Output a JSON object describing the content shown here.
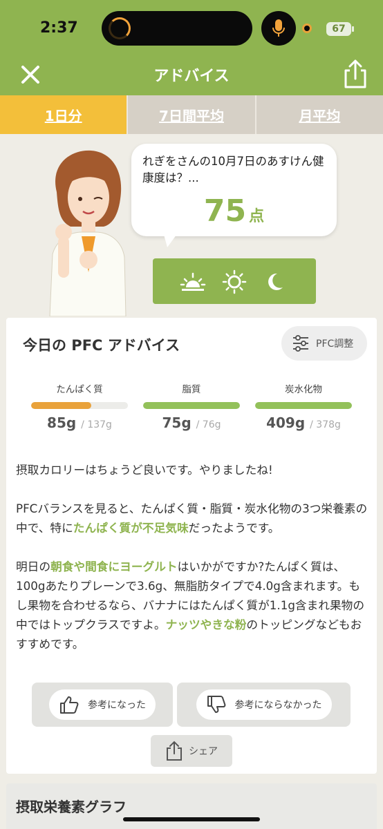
{
  "status": {
    "time": "2:37",
    "battery": "67"
  },
  "nav": {
    "title": "アドバイス"
  },
  "tabs": [
    {
      "label": "1日分",
      "active": true
    },
    {
      "label": "7日間平均",
      "active": false
    },
    {
      "label": "月平均",
      "active": false
    }
  ],
  "bubble": {
    "text": "れぎをさんの10月7日のあすけん健康度は？...",
    "score": "75",
    "score_unit": "点"
  },
  "meals": [
    "sunrise-icon",
    "sun-icon",
    "moon-icon"
  ],
  "pfc": {
    "title": "今日の PFC アドバイス",
    "adjust_label": "PFC調整",
    "nutrients": [
      {
        "label": "たんぱく質",
        "value": "85g",
        "target": "/ 137g",
        "fill": 0.62,
        "color": "#e9a23b"
      },
      {
        "label": "脂質",
        "value": "75g",
        "target": "/ 76g",
        "fill": 1.0,
        "color": "#93c15a"
      },
      {
        "label": "炭水化物",
        "value": "409g",
        "target": "/ 378g",
        "fill": 1.0,
        "color": "#93c15a"
      }
    ]
  },
  "advice": {
    "p1": "摂取カロリーはちょうど良いです。やりましたね!",
    "p2a": "PFCバランスを見ると、たんぱく質・脂質・炭水化物の3つ栄養素の中で、特に",
    "p2hl": "たんぱく質が不足気味",
    "p2b": "だったようです。",
    "p3a": "明日の",
    "p3hl1": "朝食や間食にヨーグルト",
    "p3b": "はいかがですか?たんぱく質は、100gあたりプレーンで3.6g、無脂肪タイプで4.0g含まれます。もし果物を合わせるなら、バナナにはたんぱく質が1.1g含まれ果物の中ではトップクラスですよ。",
    "p3hl2": "ナッツやきな粉",
    "p3c": "のトッピングなどもおすすめです。"
  },
  "feedback": {
    "helpful": "参考になった",
    "not_helpful": "参考にならなかった",
    "share": "シェア"
  },
  "section2": {
    "title": "摂取栄養素グラフ"
  },
  "colors": {
    "accent": "#8fb450",
    "tab_active": "#f3bf3a"
  }
}
